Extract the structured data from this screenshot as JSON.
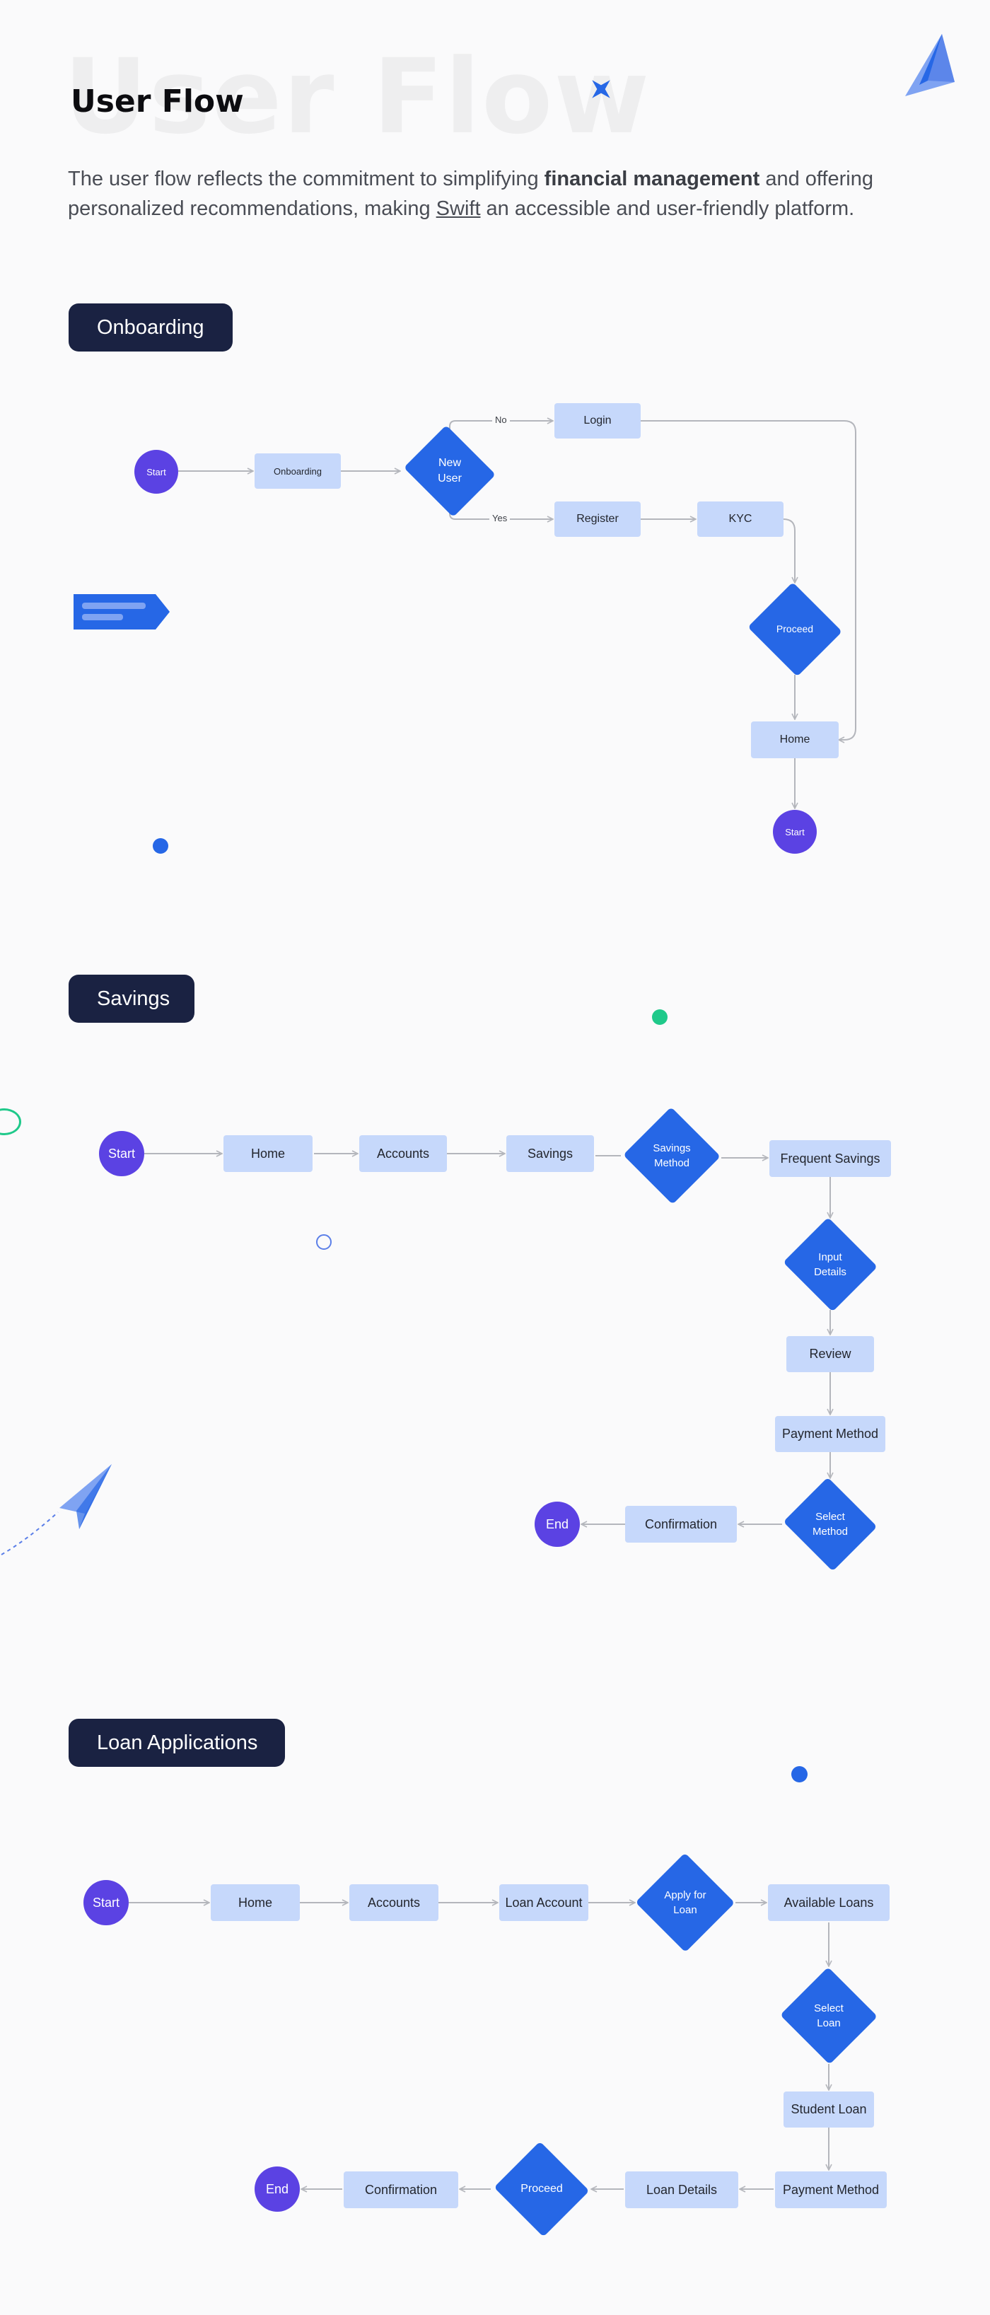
{
  "header": {
    "watermark": "User Flow",
    "title": "User Flow",
    "intro": {
      "part1": "The user flow reflects the commitment to simplifying ",
      "bold": "financial management",
      "part2": " and offering personalized recommendations, making ",
      "link": "Swift",
      "part3": " an accessible and user-friendly platform."
    }
  },
  "sections": {
    "onboarding": {
      "label": "Onboarding",
      "nodes": {
        "start": "Start",
        "onboarding": "Onboarding",
        "new_user": "New\nUser",
        "login": "Login",
        "register": "Register",
        "kyc": "KYC",
        "proceed": "Proceed",
        "home": "Home",
        "end": "Start"
      },
      "edge_labels": {
        "no": "No",
        "yes": "Yes"
      }
    },
    "savings": {
      "label": "Savings",
      "nodes": {
        "start": "Start",
        "home": "Home",
        "accounts": "Accounts",
        "savings": "Savings",
        "savings_method": "Savings\nMethod",
        "frequent_savings": "Frequent Savings",
        "input_details": "Input\nDetails",
        "review": "Review",
        "payment_method": "Payment Method",
        "select_method": "Select\nMethod",
        "confirmation": "Confirmation",
        "end": "End"
      }
    },
    "loan": {
      "label": "Loan Applications",
      "nodes": {
        "start": "Start",
        "home": "Home",
        "accounts": "Accounts",
        "loan_account": "Loan Account",
        "apply_for_loan": "Apply for\nLoan",
        "available_loans": "Available Loans",
        "select_loan": "Select\nLoan",
        "student_loan": "Student Loan",
        "payment_method": "Payment Method",
        "loan_details": "Loan Details",
        "proceed": "Proceed",
        "confirmation": "Confirmation",
        "end": "End"
      }
    }
  },
  "colors": {
    "background": "#fafafb",
    "pill": "#1a2242",
    "process_box": "#c6d8fb",
    "decision": "#2667e6",
    "terminal": "#5b42e3",
    "connector": "#b4b6bc",
    "accent_green": "#1fc98a"
  },
  "icons": [
    "paper-plane-icon",
    "sparkle-star-icon",
    "tag-flag-icon",
    "dot-icon",
    "ring-icon"
  ]
}
